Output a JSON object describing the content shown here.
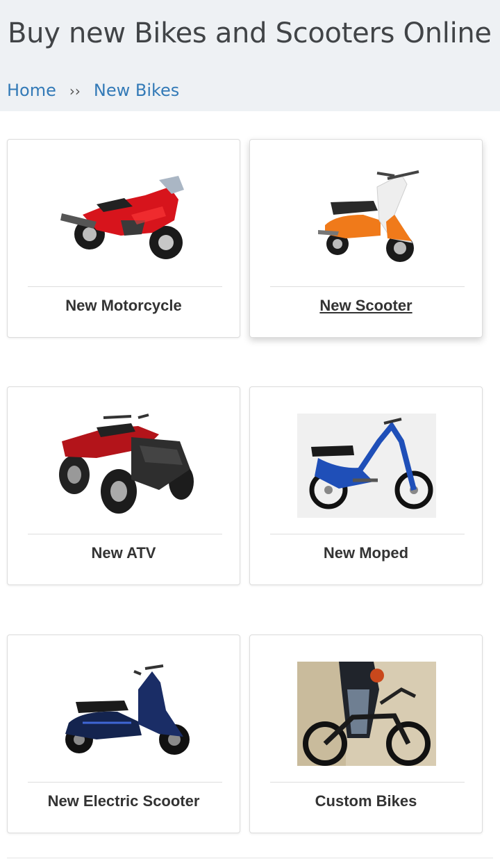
{
  "header": {
    "title": "Buy new Bikes and Scooters Online"
  },
  "breadcrumb": {
    "home": "Home",
    "separator": "››",
    "current": "New Bikes"
  },
  "categories": [
    {
      "label": "New Motorcycle"
    },
    {
      "label": "New Scooter"
    },
    {
      "label": "New ATV"
    },
    {
      "label": "New Moped"
    },
    {
      "label": "New Electric Scooter"
    },
    {
      "label": "Custom Bikes"
    }
  ],
  "colors": {
    "header_bg": "#eef1f4",
    "link": "#337ab7",
    "title": "#414447",
    "card_label": "#333333"
  }
}
